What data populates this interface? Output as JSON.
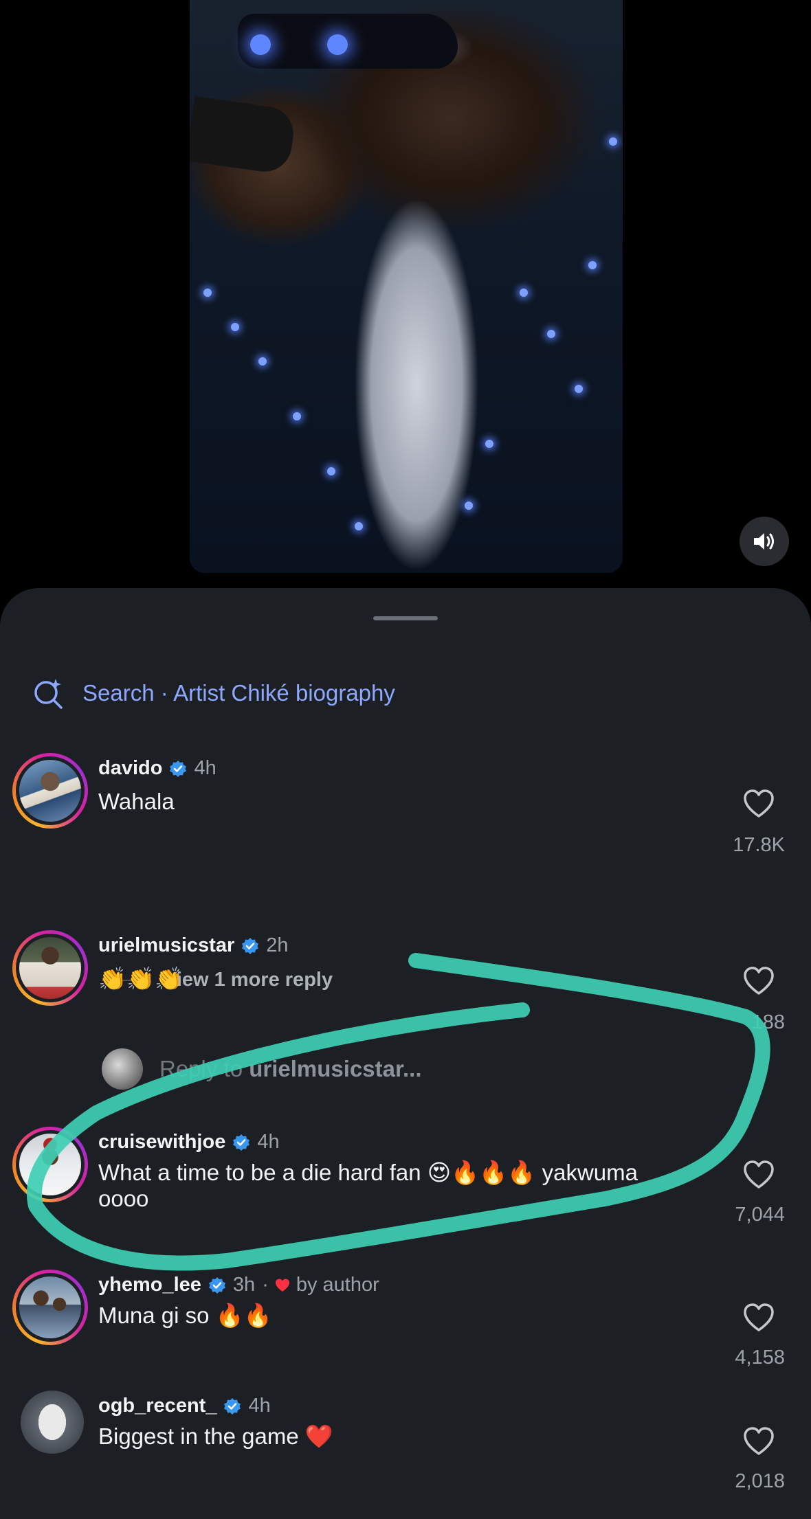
{
  "video": {
    "sound_icon": "speaker-icon"
  },
  "sheet": {
    "search_label": "Search · Artist Chiké biography",
    "view_more_label": "View 1 more reply",
    "reply_prefix": "Reply to ",
    "reply_target": "urielmusicstar...",
    "comments": [
      {
        "username": "davido",
        "time": "4h",
        "text": "Wahala",
        "likes": "17.8K"
      },
      {
        "username": "urielmusicstar",
        "time": "2h",
        "text": "👏👏👏",
        "likes": "188"
      },
      {
        "username": "cruisewithjoe",
        "time": "4h",
        "text": "What a time to be a die hard fan 😍🔥🔥🔥 yakwuma oooo",
        "likes": "7,044"
      },
      {
        "username": "yhemo_lee",
        "time": "3h",
        "meta_sep": "·",
        "meta": "by author",
        "text": "Muna gi so 🔥🔥",
        "likes": "4,158"
      },
      {
        "username": "ogb_recent_",
        "time": "4h",
        "text": "Biggest in the game ❤️",
        "likes": "2,018"
      }
    ]
  },
  "colors": {
    "accent_link": "#8ea8ff",
    "scribble": "#3ecfb4",
    "sheet_bg": "#1c1f24",
    "verified": "#3897f0",
    "heart_red": "#ff3040"
  }
}
